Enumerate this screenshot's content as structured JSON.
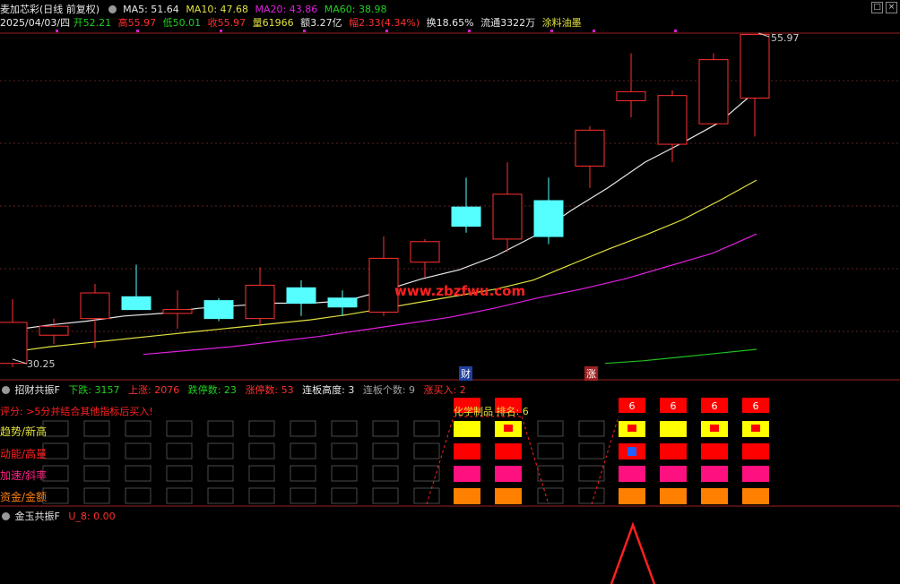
{
  "header": {
    "title": "麦加芯彩(日线 前复权)",
    "ma5": "MA5: 51.64",
    "ma10": "MA10: 47.68",
    "ma20": "MA20: 43.86",
    "ma60": "MA60: 38.98",
    "date": "2025/04/03/四",
    "open": "开52.21",
    "high": "高55.97",
    "low": "低50.01",
    "close": "收55.97",
    "volume": "量61966",
    "amount": "额3.27亿",
    "amplitude": "幅2.33(4.34%)",
    "turnover": "换18.65%",
    "float": "流通3322万",
    "sector": "涂料油墨"
  },
  "price_chart": {
    "high_label": "55.97",
    "low_label": "30.25",
    "watermark": "www.zbzfwu.com",
    "marker_cai": "财",
    "marker_zhang": "涨",
    "colors": {
      "up": "#ff3030",
      "down": "#55ffff",
      "ma5": "#e8e8e8",
      "ma10": "#e0e040",
      "ma20": "#e020e0",
      "ma60": "#20c020"
    },
    "candles": [
      {
        "o": 30.3,
        "h": 35.3,
        "l": 30.0,
        "c": 33.5
      },
      {
        "o": 32.5,
        "h": 33.8,
        "l": 31.8,
        "c": 33.2
      },
      {
        "o": 33.8,
        "h": 36.5,
        "l": 31.5,
        "c": 35.8
      },
      {
        "o": 35.5,
        "h": 38.0,
        "l": 34.6,
        "c": 34.5
      },
      {
        "o": 34.2,
        "h": 36.0,
        "l": 33.0,
        "c": 34.5
      },
      {
        "o": 35.2,
        "h": 35.4,
        "l": 33.6,
        "c": 33.8
      },
      {
        "o": 33.8,
        "h": 37.8,
        "l": 33.3,
        "c": 36.4
      },
      {
        "o": 36.2,
        "h": 36.8,
        "l": 34.0,
        "c": 35.0
      },
      {
        "o": 35.4,
        "h": 36.0,
        "l": 34.0,
        "c": 34.7
      },
      {
        "o": 34.3,
        "h": 40.2,
        "l": 34.0,
        "c": 38.5
      },
      {
        "o": 38.2,
        "h": 40.0,
        "l": 37.0,
        "c": 39.8
      },
      {
        "o": 42.5,
        "h": 44.8,
        "l": 40.5,
        "c": 41.0
      },
      {
        "o": 40.0,
        "h": 46.0,
        "l": 39.0,
        "c": 43.5
      },
      {
        "o": 43.0,
        "h": 44.8,
        "l": 39.6,
        "c": 40.2
      },
      {
        "o": 45.7,
        "h": 48.8,
        "l": 44.0,
        "c": 48.5
      },
      {
        "o": 50.8,
        "h": 54.5,
        "l": 49.5,
        "c": 51.5
      },
      {
        "o": 47.4,
        "h": 51.6,
        "l": 46.0,
        "c": 51.2
      },
      {
        "o": 49.0,
        "h": 54.5,
        "l": 49.0,
        "c": 54.0
      },
      {
        "o": 51.0,
        "h": 56.0,
        "l": 48.0,
        "c": 55.97
      }
    ],
    "ma5": [
      32.9,
      33.3,
      33.6,
      34.0,
      34.2,
      34.6,
      34.8,
      35.0,
      35.0,
      35.2,
      36.0,
      36.9,
      37.6,
      38.7,
      40.2,
      42.2,
      44.0,
      46.0,
      47.5,
      49.1,
      51.6
    ],
    "ma10": [
      31.2,
      31.6,
      31.9,
      32.2,
      32.5,
      32.8,
      33.1,
      33.4,
      33.7,
      34.1,
      34.6,
      35.1,
      35.6,
      36.1,
      36.8,
      38.0,
      39.2,
      40.3,
      41.5,
      43.0,
      44.6
    ],
    "ma20": [
      31.0,
      31.3,
      31.6,
      32.0,
      32.4,
      32.9,
      33.4,
      33.9,
      34.6,
      35.4,
      36.1,
      36.9,
      37.9,
      38.9,
      40.4
    ],
    "ma60": [
      30.3,
      30.5,
      30.8,
      31.1,
      31.4
    ]
  },
  "panel1": {
    "name": "招财共振F",
    "down": "下跌: 3157",
    "up": "上涨: 2076",
    "limit_down": "跌停数: 23",
    "limit_up": "涨停数: 53",
    "board_height": "连板高度: 3",
    "board_count": "连板个数: 9",
    "rise_buy": "涨买入: 2",
    "score_hint": "评分: >5分并结合其他指标后买入!",
    "sector_label": "化学制品 排名: 6",
    "rows": [
      "趋势/新高",
      "动能/高量",
      "加速/斜率",
      "资金/金额"
    ],
    "score_label": "6"
  },
  "panel2": {
    "name": "金玉共振F",
    "value": "U_8: 0.00"
  }
}
